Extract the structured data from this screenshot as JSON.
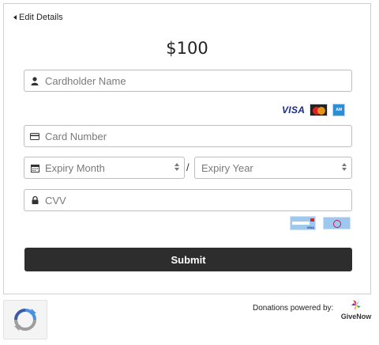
{
  "nav": {
    "back_label": "Edit Details"
  },
  "donation": {
    "amount": "$100"
  },
  "form": {
    "cardholder_placeholder": "Cardholder Name",
    "card_number_placeholder": "Card Number",
    "expiry_month_placeholder": "Expiry Month",
    "expiry_year_placeholder": "Expiry Year",
    "expiry_separator": "/",
    "cvv_placeholder": "CVV",
    "submit_label": "Submit"
  },
  "card_brands": {
    "visa": "VISA",
    "amex_icon": "amex-card-icon",
    "mastercard_icon": "mastercard-icon"
  },
  "footer": {
    "powered_by": "Donations powered by:",
    "brand": "GiveNow"
  },
  "colors": {
    "submit_bg": "#2d2d2d",
    "border": "#bdbdbd",
    "visa_blue": "#1a2c8c"
  }
}
